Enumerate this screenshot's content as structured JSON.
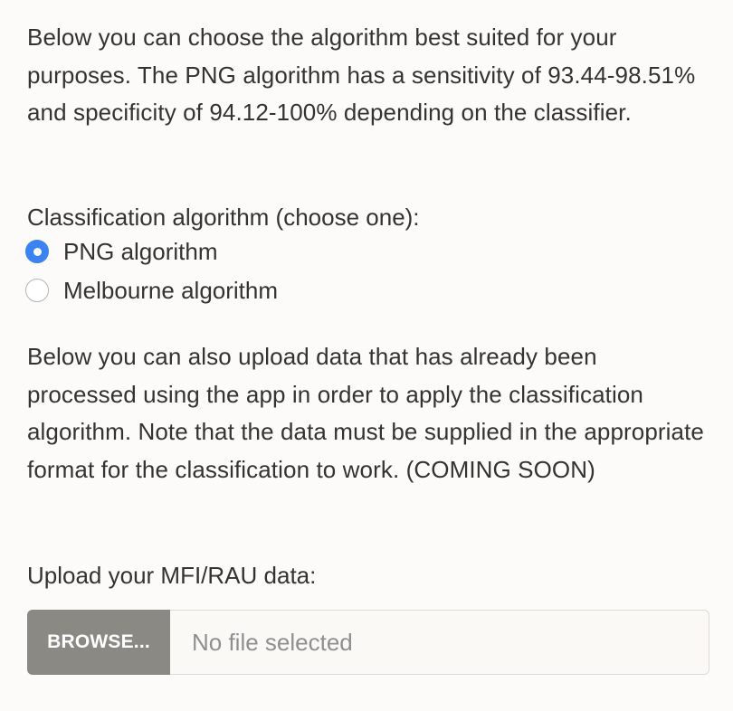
{
  "intro_text": "Below you can choose the algorithm best suited for your purposes. The PNG algorithm has a sensitivity of 93.44-98.51% and specificity of 94.12-100% depending on the classifier.",
  "classification": {
    "label": "Classification algorithm (choose one):",
    "options": [
      {
        "label": "PNG algorithm",
        "selected": true
      },
      {
        "label": "Melbourne algorithm",
        "selected": false
      }
    ]
  },
  "upload_text": "Below you can also upload data that has already been processed using the app in order to apply the classification algorithm. Note that the data must be supplied in the appropriate format for the classification to work. (COMING SOON)",
  "upload": {
    "label": "Upload your MFI/RAU data:",
    "browse_label": "BROWSE...",
    "file_placeholder": "No file selected"
  },
  "colors": {
    "radio_selected": "#3b82f2",
    "browse_button": "#8b8984",
    "background": "#fcfbf9"
  }
}
